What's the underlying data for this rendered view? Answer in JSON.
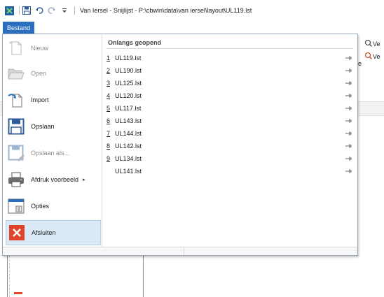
{
  "titlebar": {
    "title": "Van Iersel - Snijlijst - P:\\cbwin\\data\\van iersel\\layout\\UL119.lst"
  },
  "file_tab": {
    "label": "Bestand"
  },
  "commands": [
    {
      "label": "Nieuw",
      "enabled": false,
      "icon": "new-file-icon"
    },
    {
      "label": "Open",
      "enabled": false,
      "icon": "open-folder-icon"
    },
    {
      "label": "Import",
      "enabled": true,
      "icon": "import-icon"
    },
    {
      "label": "Opslaan",
      "enabled": true,
      "icon": "save-icon"
    },
    {
      "label": "Opslaan als...",
      "enabled": false,
      "icon": "save-as-icon"
    },
    {
      "label": "Afdruk voorbeeld",
      "enabled": true,
      "icon": "print-preview-icon",
      "submenu": "▸"
    },
    {
      "label": "Opties",
      "enabled": true,
      "icon": "options-icon"
    },
    {
      "label": "Afsluiten",
      "enabled": true,
      "icon": "close-app-icon",
      "active": true
    }
  ],
  "recent": {
    "header": "Onlangs geopend",
    "items": [
      {
        "num": "1",
        "name": "UL119.lst"
      },
      {
        "num": "2",
        "name": "UL190.lst"
      },
      {
        "num": "3",
        "name": "UL125.lst"
      },
      {
        "num": "4",
        "name": "UL120.lst"
      },
      {
        "num": "5",
        "name": "UL117.lst"
      },
      {
        "num": "6",
        "name": "UL143.lst"
      },
      {
        "num": "7",
        "name": "UL144.lst"
      },
      {
        "num": "8",
        "name": "UL142.lst"
      },
      {
        "num": "9",
        "name": "UL134.lst"
      },
      {
        "num": "",
        "name": "UL141.lst"
      }
    ]
  },
  "background": {
    "ribbon_btn_1": "Ve",
    "ribbon_btn_2": "Ve",
    "stray_letter": "e"
  },
  "colors": {
    "accent": "#2b6fc0",
    "active_bg": "#dce9f6",
    "close_red": "#e0452b"
  }
}
